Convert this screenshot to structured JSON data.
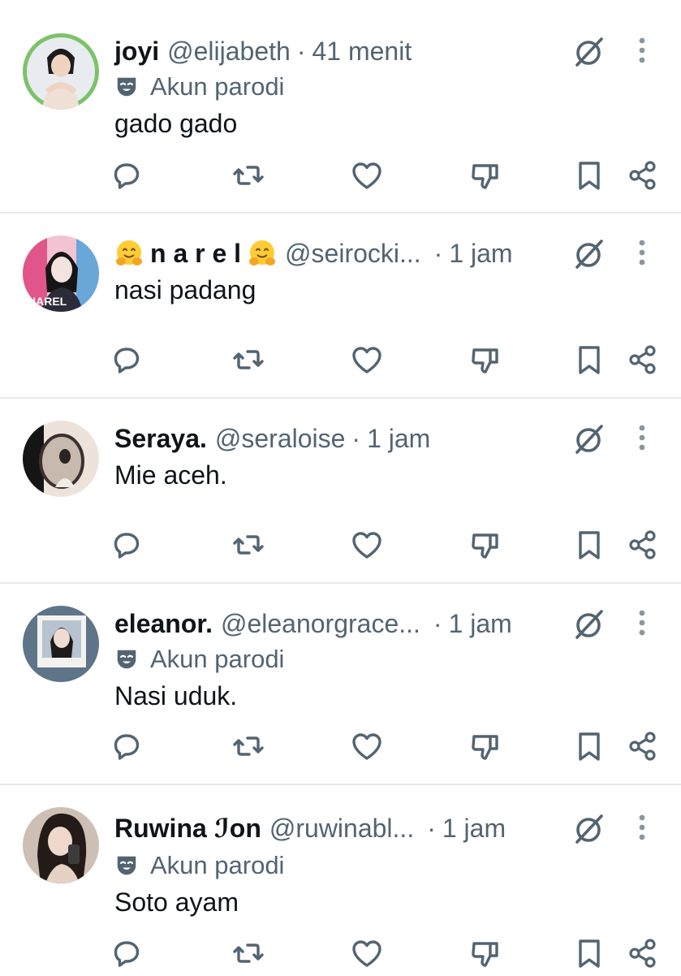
{
  "posts": [
    {
      "name": "joyi",
      "handle": "@elijabeth",
      "separator": "·",
      "time": "41 menit",
      "parody_label": "Akun parodi",
      "text": "gado gado",
      "avatar": {
        "bg": "#7cc26a",
        "desc": "woman-heart-pose"
      }
    },
    {
      "name": "n a r e l",
      "name_emoji": "hugging-face",
      "handle": "@seirocki...",
      "separator": "·",
      "time": "1 jam",
      "text": "nasi padang",
      "avatar_label": "NAREL",
      "avatar": {
        "bg": "#d94a7a",
        "desc": "girl-portrait-pink"
      }
    },
    {
      "name": "Seraya.",
      "handle": "@seraloise",
      "separator": "·",
      "time": "1 jam",
      "text": "Mie aceh.",
      "avatar": {
        "bg": "#e9d8cc",
        "desc": "mirror-selfie"
      }
    },
    {
      "name": "eleanor.",
      "handle": "@eleanorgrace...",
      "separator": "·",
      "time": "1 jam",
      "parody_label": "Akun parodi",
      "text": "Nasi uduk.",
      "avatar": {
        "bg": "#5d7489",
        "desc": "polaroid-portrait"
      }
    },
    {
      "name": "Ruwina ℐon",
      "handle": "@ruwinabl...",
      "separator": "·",
      "time": "1 jam",
      "parody_label": "Akun parodi",
      "text": "Soto ayam",
      "avatar": {
        "bg": "#3a2e2a",
        "desc": "dark-hair-selfie"
      }
    }
  ],
  "icons": {
    "reply": "reply-icon",
    "repost": "repost-icon",
    "like": "like-icon",
    "dislike": "dislike-icon",
    "bookmark": "bookmark-icon",
    "share": "share-icon",
    "grok": "grok-icon",
    "more": "more-icon",
    "parody": "parody-mask-icon"
  },
  "colors": {
    "text": "#0f1419",
    "secondary": "#536471",
    "divider": "#e6e9eb"
  }
}
